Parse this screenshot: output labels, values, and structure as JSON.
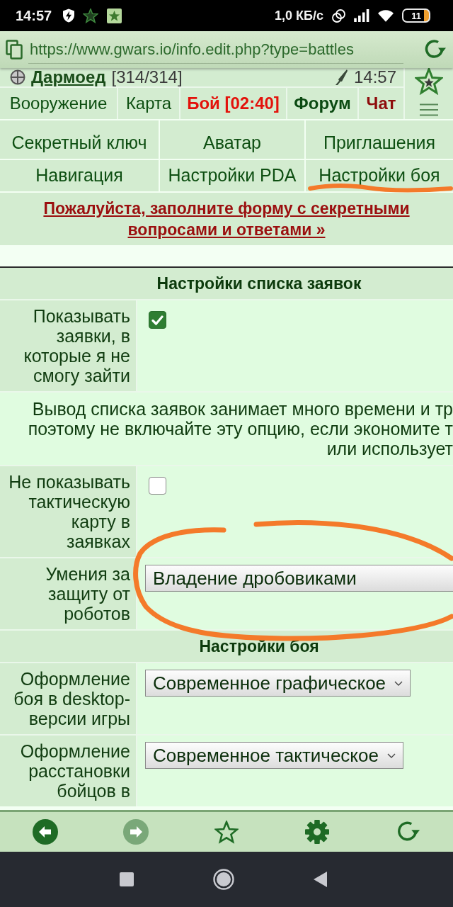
{
  "status_bar": {
    "time": "14:57",
    "net_speed": "1,0 КБ/с",
    "battery": "11"
  },
  "browser": {
    "url": "https://www.gwars.io/info.edit.php?type=battles"
  },
  "player": {
    "name": "Дармоед",
    "hp": "[314/314]",
    "time": "14:57"
  },
  "nav": [
    {
      "label": "Вооружение",
      "kind": "plain"
    },
    {
      "label": "Карта",
      "kind": "plain"
    },
    {
      "label": "Бой [02:40]",
      "kind": "alert"
    },
    {
      "label": "Форум",
      "kind": "strong"
    },
    {
      "label": "Чат",
      "kind": "hot"
    }
  ],
  "settings_links": [
    "Секретный ключ",
    "Аватар",
    "Приглашения",
    "Навигация",
    "Настройки PDA",
    "Настройки боя"
  ],
  "notice": "Пожалуйста, заполните форму с секретными вопросами и ответами »",
  "sections": [
    {
      "title": "Настройки списка заявок",
      "rows": [
        {
          "kind": "checkbox",
          "label": "Показывать заявки, в которые я не смогу зайти",
          "checked": true
        },
        {
          "kind": "note",
          "lines": [
            "Вывод списка заявок занимает много времени и тр",
            "поэтому не включайте эту опцию, если экономите т",
            "или использует"
          ]
        },
        {
          "kind": "checkbox",
          "label": "Не показывать тактическую карту в заявках",
          "checked": false
        },
        {
          "kind": "select",
          "label": "Умения за защиту от роботов",
          "value": "Владение дробовиками",
          "truncated": true
        }
      ]
    },
    {
      "title": "Настройки боя",
      "rows": [
        {
          "kind": "select",
          "label": "Оформление боя в desktop-версии игры",
          "value": "Современное графическое",
          "truncated": false
        },
        {
          "kind": "select",
          "label": "Оформление расстановки бойцов в",
          "value": "Современное тактическое",
          "truncated": false
        }
      ]
    }
  ],
  "bottom_bar": {
    "back": {
      "disabled": false
    },
    "forward": {
      "disabled": true
    }
  }
}
